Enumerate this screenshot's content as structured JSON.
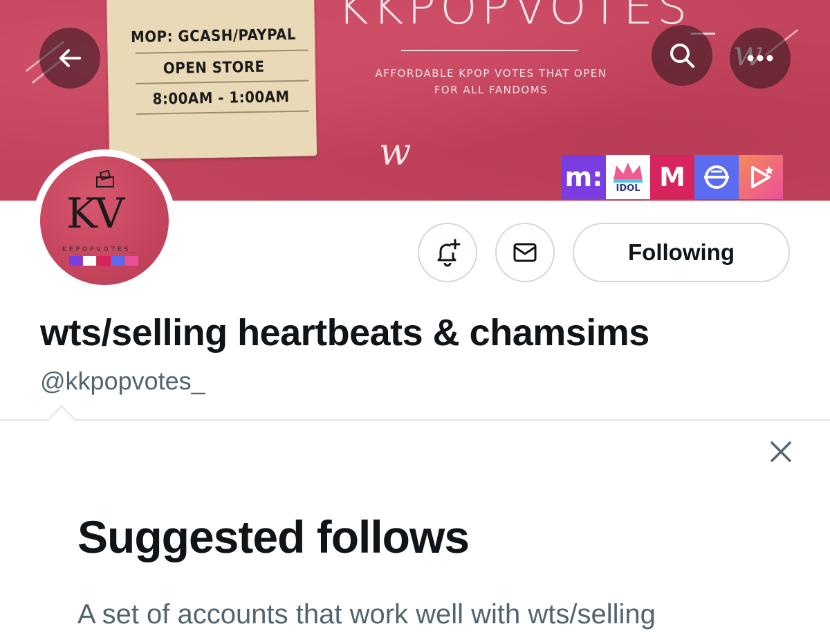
{
  "banner": {
    "title": "KKPOPVOTES_",
    "tagline": "AFFORDABLE KPOP VOTES THAT OPEN\nFOR ALL FANDOMS",
    "note_lines": [
      "MOP: GCASH/PAYPAL",
      "OPEN STORE",
      "8:00AM - 1:00AM"
    ],
    "app_icons": [
      {
        "name": "mubeat-icon",
        "glyph": "m:",
        "color": "#7a3ee0"
      },
      {
        "name": "idol-champ-icon",
        "glyph": "IDOL",
        "color": "#ffffff"
      },
      {
        "name": "mnet-plus-icon",
        "glyph": "M",
        "color": "#d7245c"
      },
      {
        "name": "starplay-icon",
        "glyph": "⊖",
        "color": "#5b6cf0"
      },
      {
        "name": "stardium-icon",
        "glyph": "▷",
        "color": "#f0609a"
      }
    ]
  },
  "avatar": {
    "monogram": "KV",
    "subtitle": "KEPOPVOTES_"
  },
  "actions": {
    "following_label": "Following"
  },
  "profile": {
    "display_name": "wts/selling heartbeats & chamsims",
    "handle": "@kkpopvotes_"
  },
  "suggested": {
    "title": "Suggested follows",
    "description": "A set of accounts that work well with wts/selling"
  },
  "colors": {
    "banner": "#c2445d",
    "text_primary": "#0f1419",
    "text_secondary": "#536471",
    "border": "#cfd9de"
  }
}
